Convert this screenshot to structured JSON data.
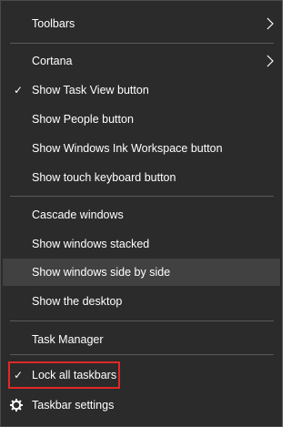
{
  "menu": {
    "items": [
      {
        "label": "Toolbars"
      },
      {
        "label": "Cortana"
      },
      {
        "label": "Show Task View button",
        "checked": true
      },
      {
        "label": "Show People button"
      },
      {
        "label": "Show Windows Ink Workspace button"
      },
      {
        "label": "Show touch keyboard button"
      },
      {
        "label": "Cascade windows"
      },
      {
        "label": "Show windows stacked"
      },
      {
        "label": "Show windows side by side",
        "highlighted": true
      },
      {
        "label": "Show the desktop"
      },
      {
        "label": "Task Manager"
      },
      {
        "label": "Lock all taskbars",
        "checked": true
      },
      {
        "label": "Taskbar settings"
      }
    ],
    "check_glyph": "✓",
    "submenu_icon": "chevron-right-icon",
    "settings_icon": "gear-icon"
  },
  "colors": {
    "menu_background": "#2b2b2b",
    "hover_background": "#414141",
    "text": "#ffffff",
    "separator": "#5a5a5a",
    "annotation_box": "#e02828"
  }
}
